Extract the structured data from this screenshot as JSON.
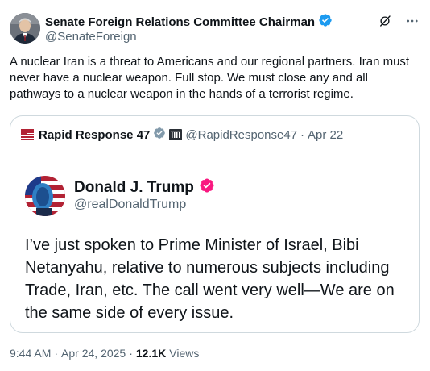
{
  "post": {
    "author_name": "Senate Foreign Relations Committee Chairman",
    "author_handle": "@SenateForeign",
    "verified_color": "#1d9bf0",
    "text": "A nuclear Iran is a threat to Americans and our regional partners. Iran must never have a nuclear weapon. Full stop. We must close any and all pathways to a nuclear weapon in the hands of a terrorist regime.",
    "icons": {
      "grok": "grok-icon",
      "more": "more-icon"
    }
  },
  "quote": {
    "account_name": "Rapid Response 47",
    "account_handle": "@RapidResponse47",
    "separator": "·",
    "date": "Apr 22",
    "badge_color": "#829aab",
    "embedded": {
      "name": "Donald J. Trump",
      "handle": "@realDonaldTrump",
      "badge_color": "#f91880",
      "text": "I’ve just spoken to Prime Minister of Israel, Bibi Netanyahu, relative to numerous subjects including Trade, Iran, etc. The call went very well—We are on the same side of every issue."
    }
  },
  "meta": {
    "time": "9:44 AM",
    "separator1": "·",
    "date": "Apr 24, 2025",
    "separator2": "·",
    "views_count": "12.1K",
    "views_label": "Views"
  }
}
